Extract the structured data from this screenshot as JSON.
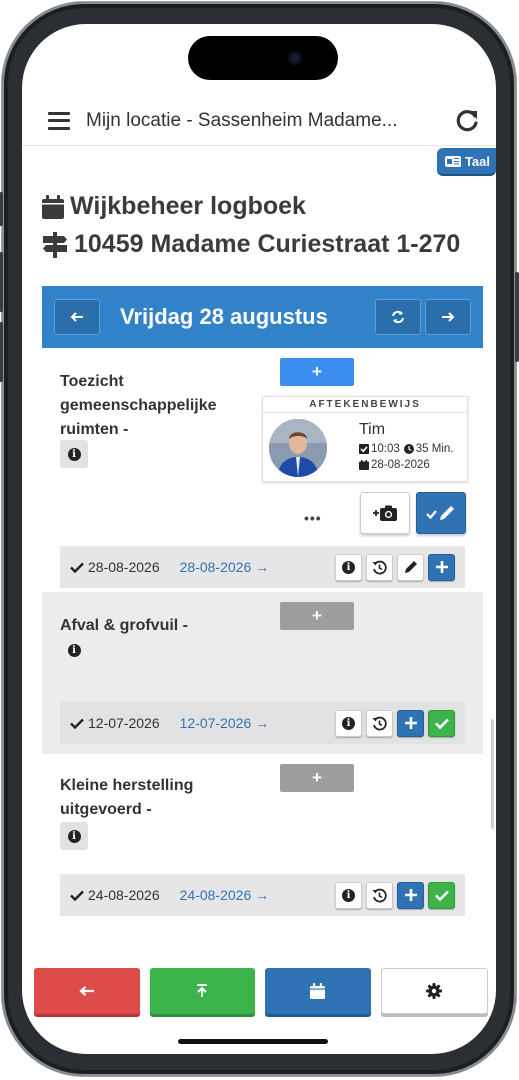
{
  "topbar": {
    "title": "Mijn locatie - Sassenheim Madame..."
  },
  "language_button": {
    "label": "Taal"
  },
  "headings": {
    "logbook": "Wijkbeheer logboek",
    "address": "10459 Madame Curiestraat 1-270"
  },
  "datebar": {
    "date": "Vrijdag 28 augustus"
  },
  "tasks": [
    {
      "name": "Toezicht gemeenschappelijke ruimten -",
      "plus_label": "+",
      "signature": {
        "header": "AFTEKENBEWIJS",
        "name": "Tim",
        "time": "10:03",
        "duration": "35 Min.",
        "date": "28-08-2026"
      },
      "more_label": "•••",
      "last_date": "28-08-2026",
      "link": "28-08-2026 →"
    },
    {
      "name": "Afval & grofvuil -",
      "plus_label": "+",
      "last_date": "12-07-2026",
      "link": "12-07-2026 →"
    },
    {
      "name": "Kleine herstelling uitgevoerd -",
      "plus_label": "+",
      "last_date": "24-08-2026",
      "link": "24-08-2026 →"
    }
  ],
  "colors": {
    "primary": "#3182c8",
    "button_blue": "#2f73b5",
    "plus_active": "#3c8df0",
    "plus_inactive": "#9e9e9e",
    "danger": "#dd4b4b",
    "success": "#3cb44b"
  },
  "icons": {
    "menu": "hamburger-icon",
    "refresh": "refresh-icon",
    "calendar": "calendar-icon",
    "signpost": "signpost-icon",
    "info": "info-icon",
    "history": "history-icon",
    "pencil": "pencil-icon",
    "check": "check-icon",
    "camera": "camera-icon",
    "back": "arrow-left-icon",
    "upload": "arrow-up-bar-icon",
    "settings": "gear-icon"
  }
}
